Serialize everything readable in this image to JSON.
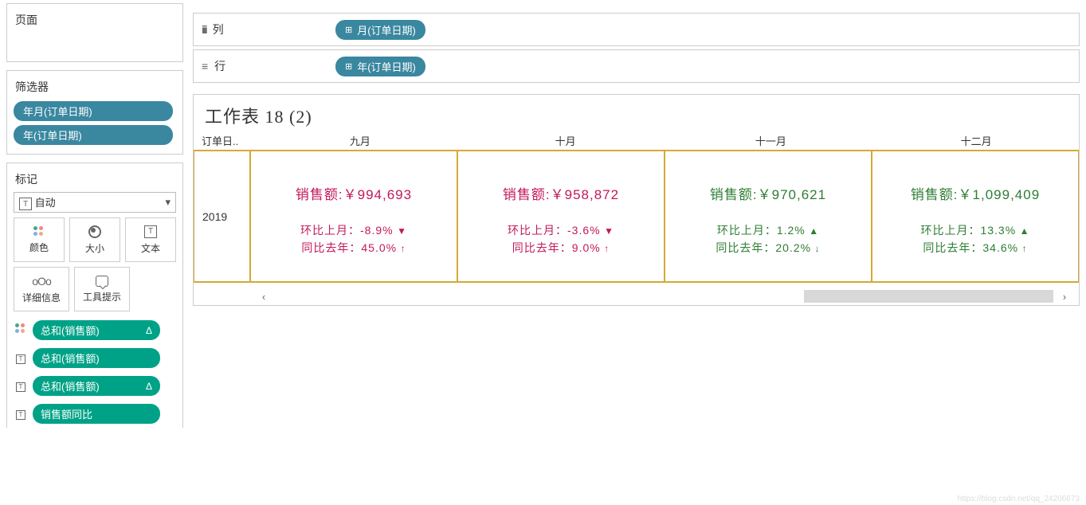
{
  "pages": {
    "title": "页面"
  },
  "filters": {
    "title": "筛选器",
    "items": [
      "年月(订单日期)",
      "年(订单日期)"
    ]
  },
  "marks": {
    "title": "标记",
    "select_label": "自动",
    "buttons": {
      "color": "颜色",
      "size": "大小",
      "text": "文本",
      "detail": "详细信息",
      "tooltip": "工具提示"
    },
    "rows": [
      {
        "icon": "dots",
        "label": "总和(销售额)",
        "delta": "Δ"
      },
      {
        "icon": "T",
        "label": "总和(销售额)",
        "delta": ""
      },
      {
        "icon": "T",
        "label": "总和(销售额)",
        "delta": "Δ"
      },
      {
        "icon": "T",
        "label": "销售额同比",
        "delta": ""
      }
    ]
  },
  "shelves": {
    "columns_label": "列",
    "columns_pill": "月(订单日期)",
    "rows_label": "行",
    "rows_pill": "年(订单日期)"
  },
  "viz": {
    "title": "工作表 18 (2)",
    "row_header": "订单日..",
    "months": [
      "九月",
      "十月",
      "十一月",
      "十二月"
    ],
    "year": "2019",
    "labels": {
      "sales": "销售额:",
      "mom": "环比上月：",
      "yoy": "同比去年："
    },
    "cells": [
      {
        "sales": "￥994,693",
        "sales_cls": "red",
        "mom": "-8.9%",
        "mom_dir": "down",
        "mom_sym": "▼",
        "yoy": "45.0%",
        "yoy_dir": "up",
        "yoy_sym": "↑"
      },
      {
        "sales": "￥958,872",
        "sales_cls": "red",
        "mom": "-3.6%",
        "mom_dir": "down",
        "mom_sym": "▼",
        "yoy": "9.0%",
        "yoy_dir": "up",
        "yoy_sym": "↑"
      },
      {
        "sales": "￥970,621",
        "sales_cls": "green",
        "mom": "1.2%",
        "mom_dir": "up",
        "mom_sym": "▲",
        "yoy": "20.2%",
        "yoy_dir": "down",
        "yoy_sym": "↓"
      },
      {
        "sales": "￥1,099,409",
        "sales_cls": "green",
        "mom": "13.3%",
        "mom_dir": "up",
        "mom_sym": "▲",
        "yoy": "34.6%",
        "yoy_dir": "up",
        "yoy_sym": "↑"
      }
    ]
  },
  "watermark": "https://blog.csdn.net/qq_24206673"
}
